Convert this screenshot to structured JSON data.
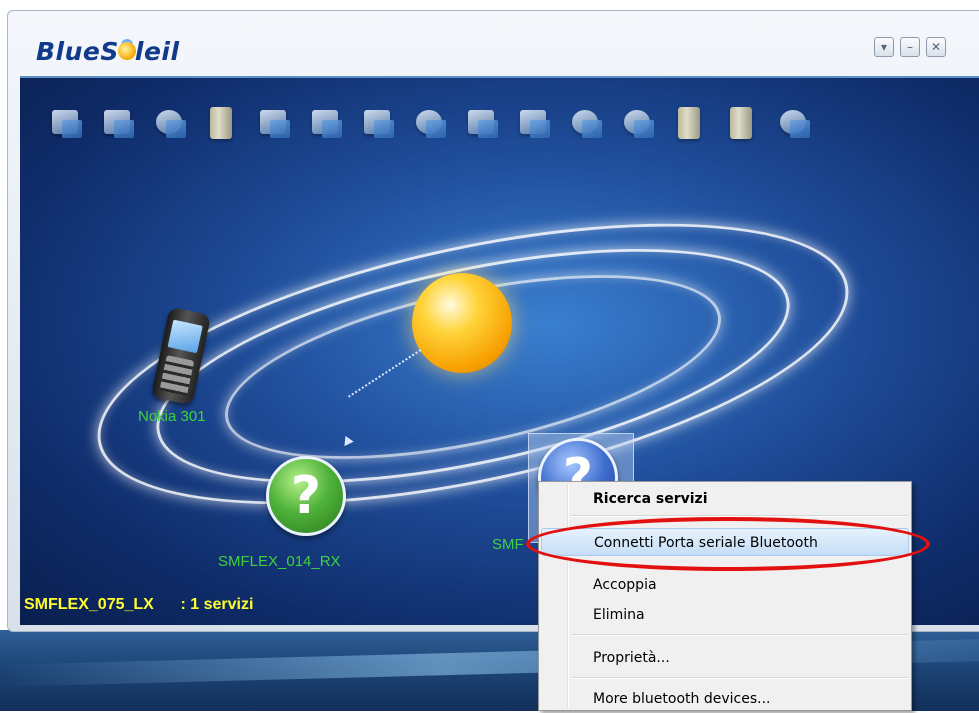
{
  "app": {
    "logo_left": "BlueS",
    "logo_right": "leil"
  },
  "titlebar": {
    "buttons": [
      {
        "name": "menu-dropdown-button",
        "icon": "chevron-down-icon",
        "glyph": "▾"
      },
      {
        "name": "minimize-button",
        "icon": "minimize-icon",
        "glyph": "–"
      },
      {
        "name": "close-button",
        "icon": "close-icon",
        "glyph": "✕"
      }
    ]
  },
  "service_icons": [
    "network-access-icon",
    "lan-access-icon",
    "serial-port-icon",
    "file-transfer-icon",
    "personal-area-network-icon",
    "object-push-icon",
    "fax-icon",
    "dialup-icon",
    "phone-icon",
    "image-transfer-icon",
    "headset-icon",
    "hands-free-icon",
    "pim-sync-icon",
    "basic-imaging-icon",
    "internet-icon"
  ],
  "devices": [
    {
      "name": "nokia-phone",
      "label": "Nokia 301",
      "kind": "phone"
    },
    {
      "name": "device-smflex-014-rx",
      "label": "SMFLEX_014_RX",
      "kind": "unknown"
    },
    {
      "name": "device-smflex-selected",
      "label": "SMF",
      "kind": "unknown-selected"
    }
  ],
  "status": {
    "device": "SMFLEX_075_LX",
    "services": ": 1 servizi"
  },
  "context_menu": {
    "items": [
      {
        "label": "Ricerca servizi",
        "bold": true
      },
      {
        "label": "Connetti Porta seriale Bluetooth",
        "hover": true
      },
      {
        "label": "Accoppia"
      },
      {
        "label": "Elimina"
      },
      {
        "label": "Proprietà..."
      },
      {
        "label": "More bluetooth devices..."
      }
    ]
  },
  "colors": {
    "device_label": "#3fd23f",
    "status_text": "#ffff30",
    "annotation_oval": "#e31010"
  }
}
